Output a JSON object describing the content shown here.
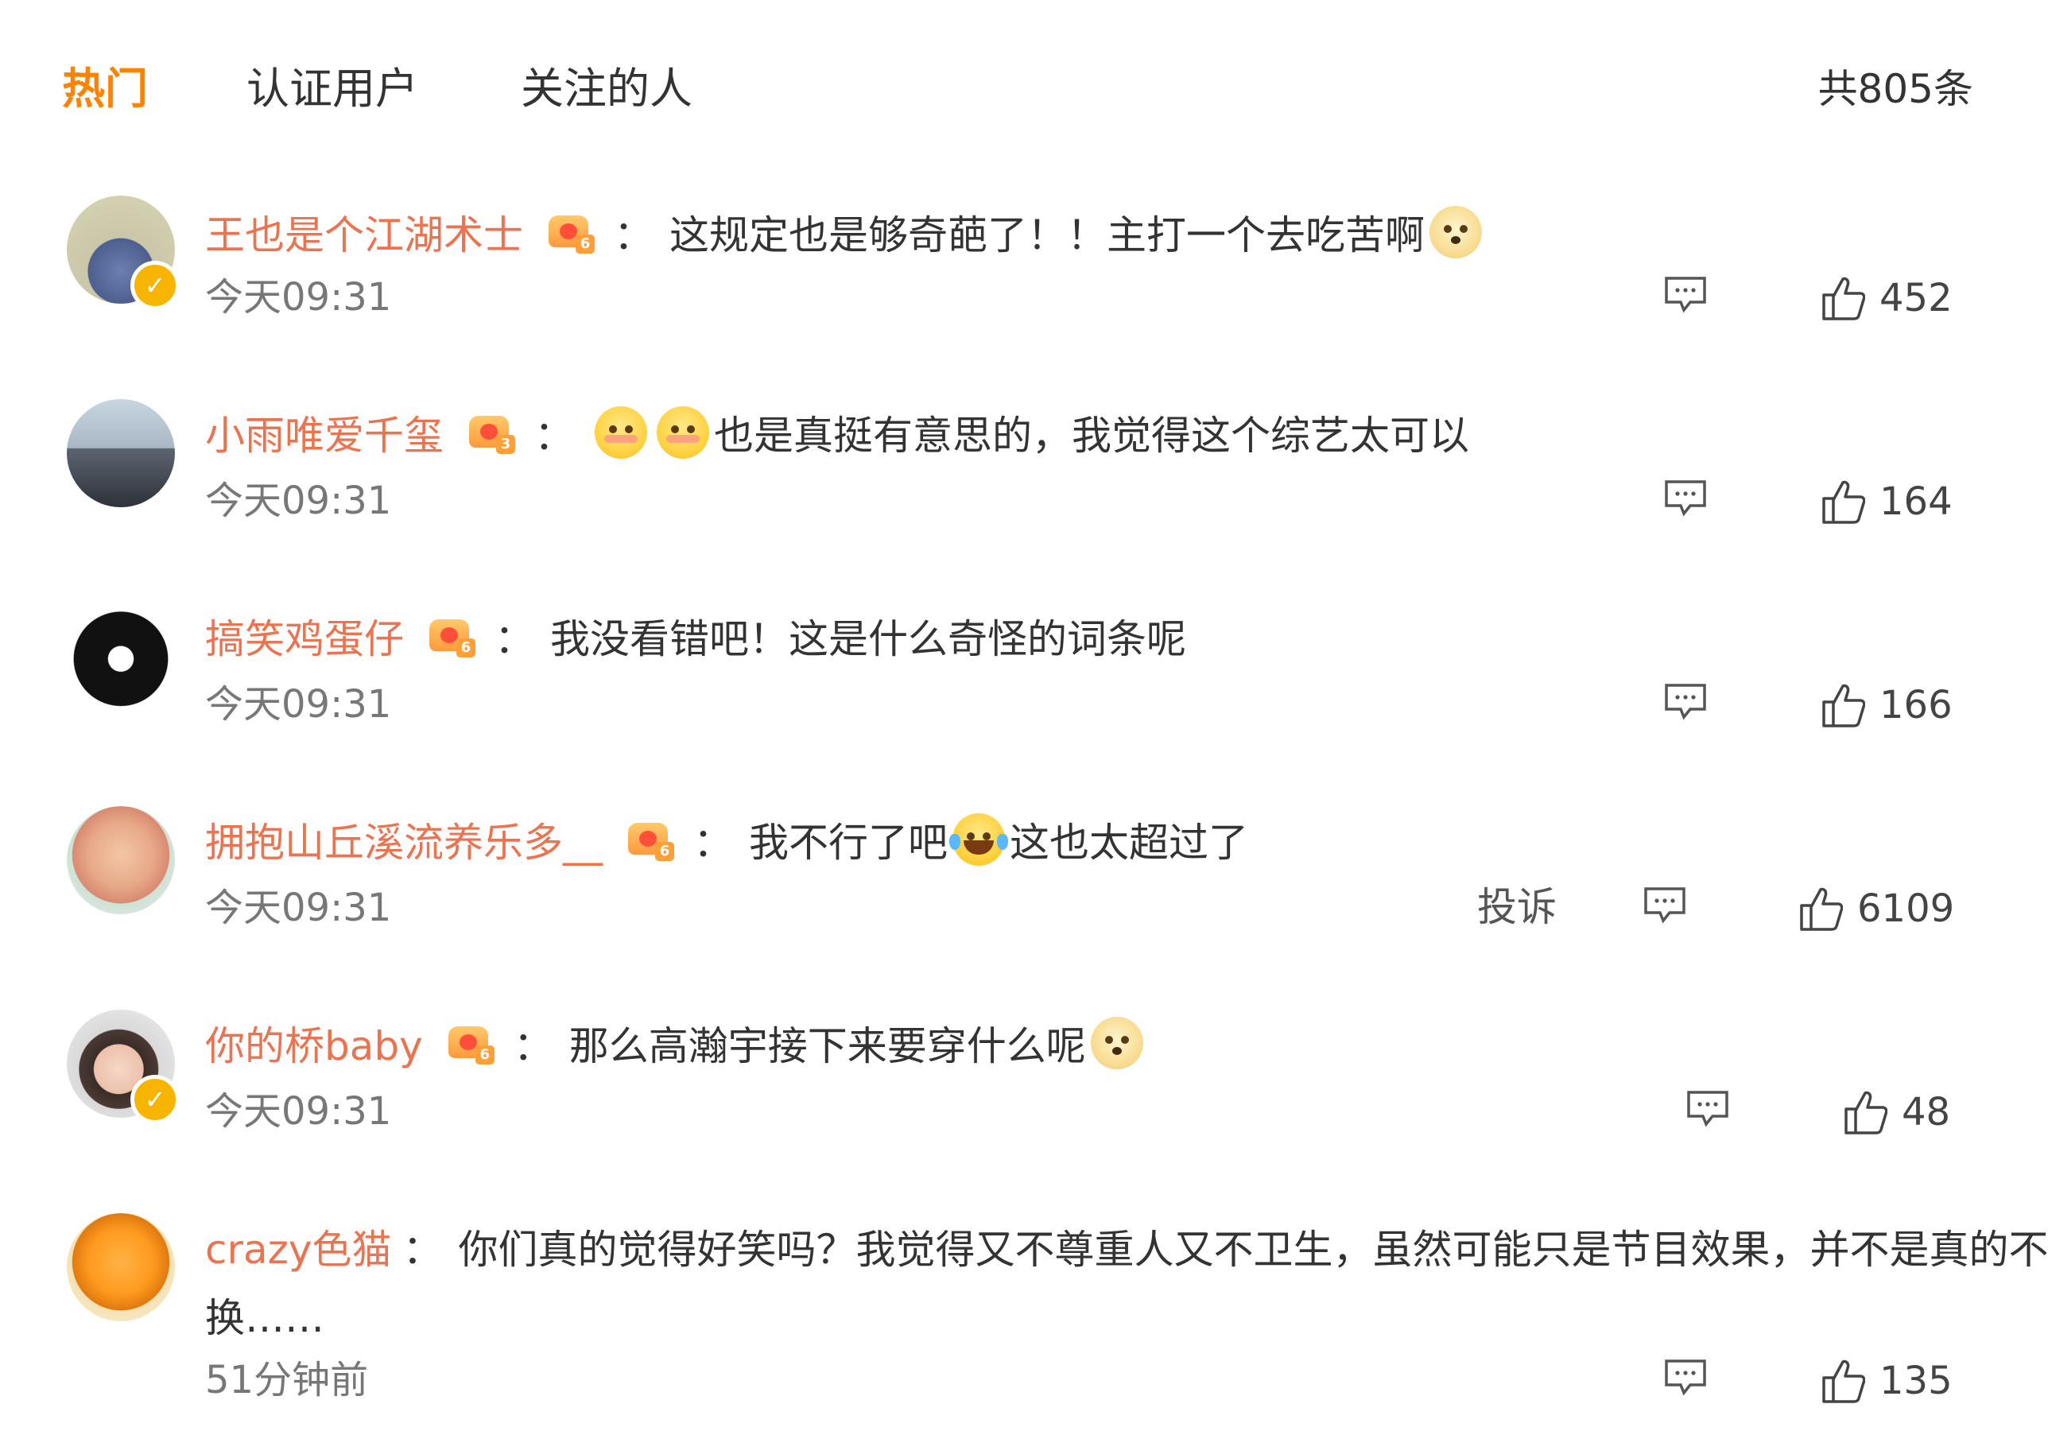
{
  "tabs": {
    "hot": "热门",
    "verified": "认证用户",
    "following": "关注的人"
  },
  "total": "共805条",
  "actions": {
    "report": "投诉"
  },
  "comments": [
    {
      "name": "王也是个江湖术士",
      "level": "6",
      "colon": "：",
      "text_a": "这规定也是够奇葩了！！主打一个去吃苦啊",
      "text_b": "",
      "text_c": "",
      "time": "今天09:31",
      "likes": "452",
      "verified": true
    },
    {
      "name": "小雨唯爱千玺",
      "level": "3",
      "colon": "：",
      "text_a": "",
      "text_b": "也是真挺有意思的，我觉得这个综艺太可以",
      "text_c": "",
      "time": "今天09:31",
      "likes": "164",
      "verified": false
    },
    {
      "name": "搞笑鸡蛋仔",
      "level": "6",
      "colon": "：",
      "text_a": "我没看错吧！这是什么奇怪的词条呢",
      "text_b": "",
      "text_c": "",
      "time": "今天09:31",
      "likes": "166",
      "verified": false
    },
    {
      "name": "拥抱山丘溪流养乐多__",
      "level": "6",
      "colon": "：",
      "text_a": "我不行了吧",
      "text_b": "这也太超过了",
      "text_c": "",
      "time": "今天09:31",
      "likes": "6109",
      "verified": false
    },
    {
      "name": "你的桥baby",
      "level": "6",
      "colon": "：",
      "text_a": "那么高瀚宇接下来要穿什么呢",
      "text_b": "",
      "text_c": "",
      "time": "今天09:31",
      "likes": "48",
      "verified": true
    },
    {
      "name": "crazy色猫",
      "level": "",
      "colon": "：",
      "text_a": "你们真的觉得好笑吗？我觉得又不尊重人又不卫生，虽然可能只是节目效果，并不是真的不",
      "text_b": "换……",
      "text_c": "",
      "time": "51分钟前",
      "likes": "135",
      "verified": false
    }
  ],
  "colors": {
    "accent": "#ff8200",
    "username": "#eb7350"
  },
  "icons": [
    "verified-badge-icon",
    "level-crown-icon",
    "comment-icon",
    "thumbs-up-icon",
    "emoji-icon"
  ]
}
